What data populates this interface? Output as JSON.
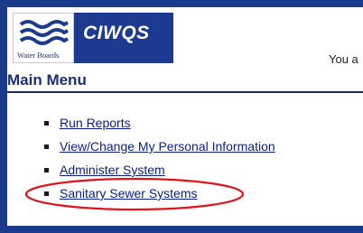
{
  "header": {
    "logo_caption": "Water Boards",
    "app_name": "CIWQS",
    "greeting": "You a"
  },
  "main_menu": {
    "title": "Main Menu",
    "items": [
      {
        "label": "Run Reports"
      },
      {
        "label": "View/Change My Personal Information"
      },
      {
        "label": "Administer System"
      },
      {
        "label": "Sanitary Sewer Systems"
      }
    ]
  },
  "colors": {
    "frame_blue": "#1a3b8c",
    "link_blue": "#0a1f86",
    "highlight_red": "#e0141b"
  }
}
